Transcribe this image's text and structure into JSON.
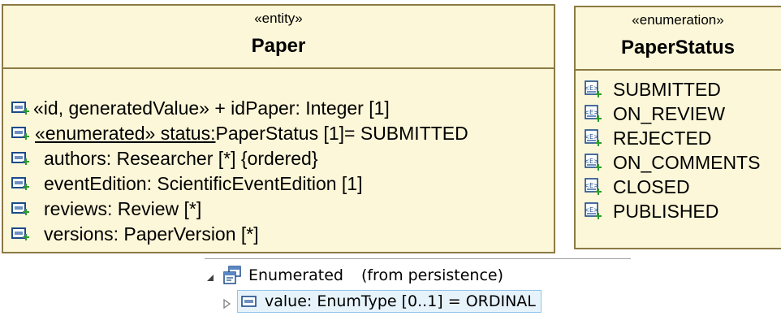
{
  "paper": {
    "stereotype": "«entity»",
    "name": "Paper",
    "attributes": [
      {
        "pre": "«id, generatedValue» + idPaper: Integer [1]",
        "underlined": "",
        "post": ""
      },
      {
        "pre": "",
        "underlined": "«enumerated» status:",
        "post": "PaperStatus [1]= SUBMITTED"
      },
      {
        "pre": "authors: Researcher [*] {ordered}",
        "underlined": "",
        "post": ""
      },
      {
        "pre": "eventEdition: ScientificEventEdition [1]",
        "underlined": "",
        "post": ""
      },
      {
        "pre": "reviews: Review [*]",
        "underlined": "",
        "post": ""
      },
      {
        "pre": "versions: PaperVersion [*]",
        "underlined": "",
        "post": ""
      }
    ]
  },
  "status": {
    "stereotype": "«enumeration»",
    "name": "PaperStatus",
    "literals": [
      "SUBMITTED",
      "ON_REVIEW",
      "REJECTED",
      "ON_COMMENTS",
      "CLOSED",
      "PUBLISHED"
    ]
  },
  "tree": {
    "item1_name": "Enumerated",
    "item1_source": "(from persistence)",
    "item2_label": "value: EnumType [0..1] = ORDINAL"
  },
  "colors": {
    "box_fill": "#fcf7d8",
    "box_border": "#8c7a44",
    "attr_icon": "#1b4a8a",
    "attr_icon_plus": "#2e9a2e",
    "selection": "#e7f3fb"
  }
}
